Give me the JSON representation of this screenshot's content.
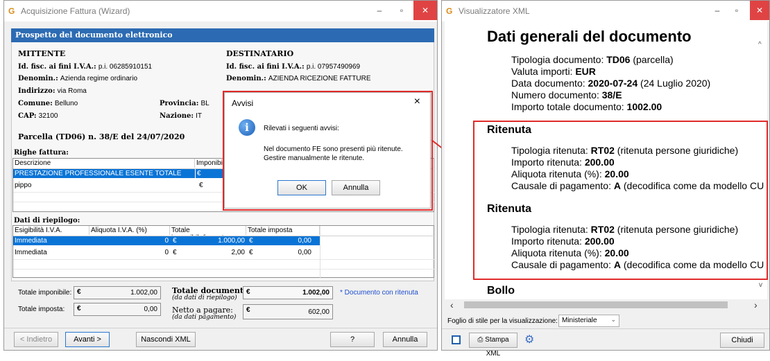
{
  "left_window": {
    "title": "Acquisizione Fattura (Wizard)",
    "section_title": "Prospetto del documento elettronico",
    "mittente": {
      "heading": "MITTENTE",
      "idfisc_label": "Id. fisc. ai fini I.V.A.:",
      "idfisc_value": "p.i. 06285910151",
      "denom_label": "Denomin.:",
      "denom_value": "Azienda regime ordinario",
      "indirizzo_label": "Indirizzo:",
      "indirizzo_value": "via Roma",
      "comune_label": "Comune:",
      "comune_value": "Belluno",
      "provincia_label": "Provincia:",
      "provincia_value": "BL",
      "cap_label": "CAP:",
      "cap_value": "32100",
      "nazione_label": "Nazione:",
      "nazione_value": "IT"
    },
    "destinatario": {
      "heading": "DESTINATARIO",
      "idfisc_label": "Id. fisc. ai fini I.V.A.:",
      "idfisc_value": "p.i. 07957490969",
      "denom_label": "Denomin.:",
      "denom_value": "AZIENDA RICEZIONE FATTURE"
    },
    "doc_title": "Parcella (TD06) n. 38/E del 24/07/2020",
    "righe": {
      "label": "Righe fattura:",
      "headers": [
        "Descrizione",
        "Imponibile"
      ],
      "rows": [
        {
          "desc": "PRESTAZIONE PROFESSIONALE ESENTE TOTALE",
          "cur": "€",
          "selected": true
        },
        {
          "desc": "pippo",
          "cur": "€",
          "selected": false
        }
      ]
    },
    "riepilogo": {
      "label": "Dati di riepilogo:",
      "headers": [
        "Esigibilità I.V.A.",
        "Aliquota I.V.A. (%)",
        "Totale imponibile/importo",
        "Totale imposta"
      ],
      "rows": [
        {
          "esig": "Immediata",
          "aliq": "0",
          "cur1": "€",
          "imp": "1.000,00",
          "cur2": "€",
          "tax": "0,00",
          "selected": true
        },
        {
          "esig": "Immediata",
          "aliq": "0",
          "cur1": "€",
          "imp": "2,00",
          "cur2": "€",
          "tax": "0,00",
          "selected": false
        }
      ]
    },
    "totali": {
      "imponibile_label": "Totale imponibile:",
      "imponibile_cur": "€",
      "imponibile_value": "1.002,00",
      "imposta_label": "Totale imposta:",
      "imposta_cur": "€",
      "imposta_value": "0,00",
      "documento_label": "Totale documento:",
      "documento_sub": "(da dati di riepilogo)",
      "documento_cur": "€",
      "documento_value": "1.002,00",
      "netto_label": "Netto a pagare:",
      "netto_sub": "(da dati pagamento)",
      "netto_cur": "€",
      "netto_value": "602,00",
      "note": "* Documento con ritenuta"
    },
    "buttons": {
      "indietro": "< Indietro",
      "avanti": "Avanti >",
      "nascondi": "Nascondi XML",
      "help": "?",
      "annulla": "Annulla"
    }
  },
  "dialog": {
    "title": "Avvisi",
    "close": "×",
    "heading": "Rilevati i seguenti avvisi:",
    "line1": "Nel documento FE sono presenti più ritenute.",
    "line2": "Gestire manualmente le ritenute.",
    "ok": "OK",
    "annulla": "Annulla"
  },
  "right_window": {
    "title": "Visualizzatore XML",
    "heading": "Dati generali del documento",
    "generali": {
      "tipologia_label": "Tipologia documento: ",
      "tipologia_value": "TD06",
      "tipologia_desc": " (parcella)",
      "valuta_label": "Valuta importi: ",
      "valuta_value": "EUR",
      "data_label": "Data documento: ",
      "data_value": "2020-07-24",
      "data_desc": " (24 Luglio 2020)",
      "numero_label": "Numero documento: ",
      "numero_value": "38/E",
      "importo_label": "Importo totale documento: ",
      "importo_value": "1002.00"
    },
    "ritenute": [
      {
        "heading": "Ritenuta",
        "tipo_label": "Tipologia ritenuta: ",
        "tipo_value": "RT02",
        "tipo_desc": " (ritenuta persone giuridiche)",
        "importo_label": "Importo ritenuta: ",
        "importo_value": "200.00",
        "aliquota_label": "Aliquota ritenuta (%): ",
        "aliquota_value": "20.00",
        "causale_label": "Causale di pagamento: ",
        "causale_value": "A",
        "causale_desc": " (decodifica come da modello CU"
      },
      {
        "heading": "Ritenuta",
        "tipo_label": "Tipologia ritenuta: ",
        "tipo_value": "RT02",
        "tipo_desc": " (ritenuta persone giuridiche)",
        "importo_label": "Importo ritenuta: ",
        "importo_value": "200.00",
        "aliquota_label": "Aliquota ritenuta (%): ",
        "aliquota_value": "20.00",
        "causale_label": "Causale di pagamento: ",
        "causale_value": "A",
        "causale_desc": " (decodifica come da modello CU"
      }
    ],
    "bollo_heading": "Bollo",
    "stylesheet_label": "Foglio di stile per la visualizzazione:",
    "stylesheet_value": "Ministeriale",
    "stampa": "Stampa XML",
    "chiudi": "Chiudi"
  },
  "colors": {
    "section_blue": "#2c6bb3",
    "selection_blue": "#0a74d6",
    "highlight_red": "#e02a2a",
    "close_red": "#e04343",
    "note_blue": "#1f4fd0"
  }
}
